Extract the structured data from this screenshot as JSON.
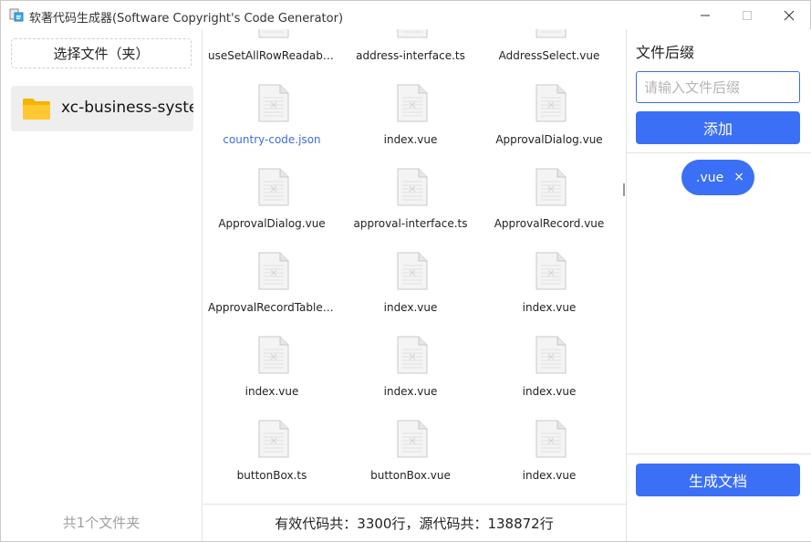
{
  "window": {
    "title": "软著代码生成器(Software Copyright's Code Generator)"
  },
  "left": {
    "select_button": "选择文件（夹）",
    "folders": [
      {
        "name": "xc-business-syste"
      }
    ],
    "count_text": "共1个文件夹"
  },
  "files": [
    {
      "name": "useSetAllRowReadabl...",
      "active": false
    },
    {
      "name": "address-interface.ts",
      "active": false
    },
    {
      "name": "AddressSelect.vue",
      "active": false
    },
    {
      "name": "country-code.json",
      "active": true
    },
    {
      "name": "index.vue",
      "active": false
    },
    {
      "name": "ApprovalDialog.vue",
      "active": false
    },
    {
      "name": "ApprovalDialog.vue",
      "active": false
    },
    {
      "name": "approval-interface.ts",
      "active": false
    },
    {
      "name": "ApprovalRecord.vue",
      "active": false
    },
    {
      "name": "ApprovalRecordTable....",
      "active": false
    },
    {
      "name": "index.vue",
      "active": false
    },
    {
      "name": "index.vue",
      "active": false
    },
    {
      "name": "index.vue",
      "active": false
    },
    {
      "name": "index.vue",
      "active": false
    },
    {
      "name": "index.vue",
      "active": false
    },
    {
      "name": "buttonBox.ts",
      "active": false
    },
    {
      "name": "buttonBox.vue",
      "active": false
    },
    {
      "name": "index.vue",
      "active": false
    }
  ],
  "status": {
    "text": "有效代码共：3300行，源代码共：138872行"
  },
  "right": {
    "suffix_label": "文件后缀",
    "suffix_input": {
      "value": "",
      "placeholder": "请输入文件后缀"
    },
    "add_button": "添加",
    "tags": [
      {
        "label": ".vue"
      }
    ],
    "tag_close_glyph": "×",
    "generate_button": "生成文档"
  },
  "colors": {
    "primary": "#3b6ff5",
    "link": "#3d6ed8",
    "folder": "#f9c21e"
  },
  "icons": {
    "app": "app-icon",
    "folder": "folder-icon",
    "file": "file-icon",
    "close": "close-icon"
  }
}
